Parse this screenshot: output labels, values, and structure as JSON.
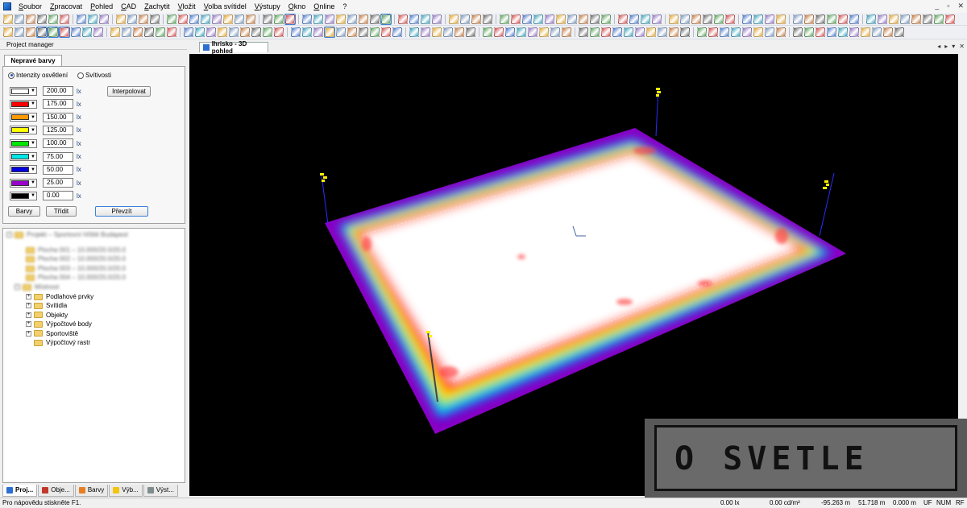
{
  "menu": {
    "items": [
      "Soubor",
      "Zpracovat",
      "Pohled",
      "CAD",
      "Zachytit",
      "Vložit",
      "Volba svítidel",
      "Výstupy",
      "Okno",
      "Online",
      "?"
    ]
  },
  "window_controls": [
    "_",
    "▫",
    "✕"
  ],
  "project_manager": {
    "title": "Project manager",
    "tab": "Nepravé barvy",
    "radio_illuminance": "Intenzity osvětlení",
    "radio_luminance": "Svítivosti",
    "interpolate_button": "Interpolovat",
    "unit": "lx",
    "levels": [
      {
        "value": "200.00",
        "color": "#ffffff"
      },
      {
        "value": "175.00",
        "color": "#ff0000"
      },
      {
        "value": "150.00",
        "color": "#ff9900"
      },
      {
        "value": "125.00",
        "color": "#ffff00"
      },
      {
        "value": "100.00",
        "color": "#00e600"
      },
      {
        "value": "75.00",
        "color": "#00e6e6"
      },
      {
        "value": "50.00",
        "color": "#0000dd"
      },
      {
        "value": "25.00",
        "color": "#9900cc"
      },
      {
        "value": "0.00",
        "color": "#000000"
      }
    ],
    "buttons": {
      "colors": "Barvy",
      "sort": "Třídit",
      "apply": "Převzít"
    }
  },
  "tree": {
    "blurred": [
      "Projekt – Sportovní hřiště Budapest",
      "Plocha 001 – 10.000/20.0/20.0",
      "Plocha 002 – 10.000/20.0/20.0",
      "Plocha 003 – 10.000/20.0/20.0",
      "Plocha 004 – 10.000/20.0/20.0",
      "Místnost"
    ],
    "items": [
      "Podlahové prvky",
      "Svítidla",
      "Objekty",
      "Výpočtové body",
      "Sportoviště",
      "Výpočtový rastr"
    ]
  },
  "bottom_tabs": [
    {
      "label": "Proj...",
      "icon_color": "#2a6fd1"
    },
    {
      "label": "Obje...",
      "icon_color": "#c0392b"
    },
    {
      "label": "Barvy",
      "icon_color": "#e67e22"
    },
    {
      "label": "Výb...",
      "icon_color": "#f1c40f"
    },
    {
      "label": "Výst...",
      "icon_color": "#7f8c8d"
    }
  ],
  "view": {
    "tab_title": "Ihrisko - 3D pohled",
    "controls": [
      "◂",
      "▸",
      "▾",
      "✕"
    ]
  },
  "status": {
    "help": "Pro nápovědu stiskněte F1.",
    "illuminance": "0.00 lx",
    "luminance": "0.00 cd/m²",
    "x": "-95.263 m",
    "y": "51.718 m",
    "z": "0.000 m",
    "flags": [
      "UF",
      "NUM",
      "RF"
    ]
  },
  "watermark": "O SVETLE"
}
